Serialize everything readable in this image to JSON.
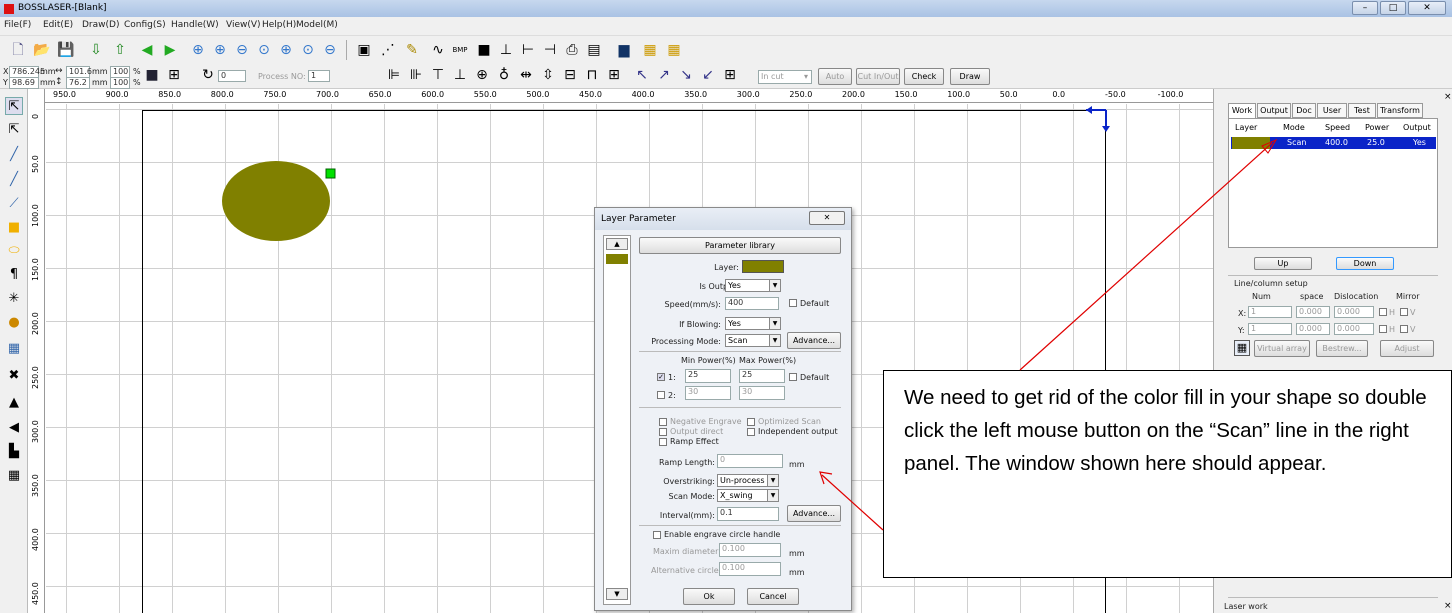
{
  "window": {
    "title": "BOSSLASER-[Blank]",
    "min": "–",
    "max": "□",
    "close": "✕"
  },
  "menu": [
    "File(F)",
    "Edit(E)",
    "Draw(D)",
    "Config(S)",
    "Handle(W)",
    "View(V)",
    "Help(H)",
    "Model(M)"
  ],
  "coords": {
    "x_label": "X",
    "x_value": "786.245",
    "y_label": "Y",
    "y_value": "98.69",
    "unit": "mm",
    "width": "101.6",
    "height": "76.2",
    "scale_w": "100",
    "scale_h": "100",
    "pct": "%"
  },
  "toolbar2": {
    "rotation": "0",
    "process_no_label": "Process NO:",
    "process_no": "1",
    "cut_combo": "In cut",
    "auto": "Auto",
    "cut_inout": "Cut In/Out",
    "check": "Check",
    "draw": "Draw"
  },
  "hruler": [
    "950.0",
    "900.0",
    "850.0",
    "800.0",
    "750.0",
    "700.0",
    "650.0",
    "600.0",
    "550.0",
    "500.0",
    "450.0",
    "400.0",
    "350.0",
    "300.0",
    "250.0",
    "200.0",
    "150.0",
    "100.0",
    "50.0",
    "0.0",
    "-50.0",
    "-100.0"
  ],
  "vruler": [
    "0",
    "50.0",
    "100.0",
    "150.0",
    "200.0",
    "250.0",
    "300.0",
    "350.0",
    "400.0",
    "450.0"
  ],
  "panel": {
    "tabs": [
      "Work",
      "Output",
      "Doc",
      "User",
      "Test",
      "Transform"
    ],
    "columns": [
      "Layer",
      "Mode",
      "Speed",
      "Power",
      "Output"
    ],
    "row": {
      "mode": "Scan",
      "speed": "400.0",
      "power": "25.0",
      "output": "Yes",
      "color": "#808000"
    },
    "up": "Up",
    "down": "Down",
    "linecol": {
      "title": "Line/column setup",
      "num": "Num",
      "space": "space",
      "dislocation": "Dislocation",
      "mirror": "Mirror",
      "x": "X:",
      "y": "Y:",
      "x_num": "1",
      "x_space": "0.000",
      "x_disl": "0.000",
      "y_num": "1",
      "y_space": "0.000",
      "y_disl": "0.000",
      "h": "H",
      "v": "V"
    },
    "virtual_array": "Virtual array",
    "bestrew": "Bestrew...",
    "adjust": "Adjust",
    "laser_work": "Laser work"
  },
  "dialog": {
    "title": "Layer Parameter",
    "close": "✕",
    "param_library": "Parameter library",
    "layer_label": "Layer:",
    "layer_color": "#808000",
    "is_output_label": "Is Output:",
    "is_output": "Yes",
    "speed_label": "Speed(mm/s):",
    "speed": "400",
    "default": "Default",
    "if_blowing_label": "If Blowing:",
    "if_blowing": "Yes",
    "processing_mode_label": "Processing Mode:",
    "processing_mode": "Scan",
    "advance": "Advance...",
    "min_power": "Min Power(%)",
    "max_power": "Max Power(%)",
    "p1_label": "1:",
    "p1_min": "25",
    "p1_max": "25",
    "p2_label": "2:",
    "p2_min": "30",
    "p2_max": "30",
    "neg_engrave": "Negative Engrave",
    "opt_scan": "Optimized Scan",
    "output_direct": "Output direct",
    "indep_output": "Independent output",
    "ramp_effect": "Ramp Effect",
    "ramp_length_label": "Ramp Length:",
    "ramp_length": "0",
    "mm": "mm",
    "overstriking_label": "Overstriking:",
    "overstriking": "Un-process",
    "scan_mode_label": "Scan Mode:",
    "scan_mode": "X_swing",
    "interval_label": "Interval(mm):",
    "interval": "0.1",
    "advance2": "Advance...",
    "enable_circle": "Enable engrave circle handle",
    "max_diam_label": "Maxim diameter:",
    "max_diam": "0.100",
    "alt_circle_label": "Alternative circle",
    "alt_circle": "0.100",
    "ok": "Ok",
    "cancel": "Cancel"
  },
  "callout": "We need to get rid of the color fill in your shape so double click the left mouse button on the “Scan” line in the right panel.  The window shown here should appear.",
  "colors": {
    "fill": "#808000",
    "select": "#0a24c8",
    "arrow": "#e00000"
  }
}
